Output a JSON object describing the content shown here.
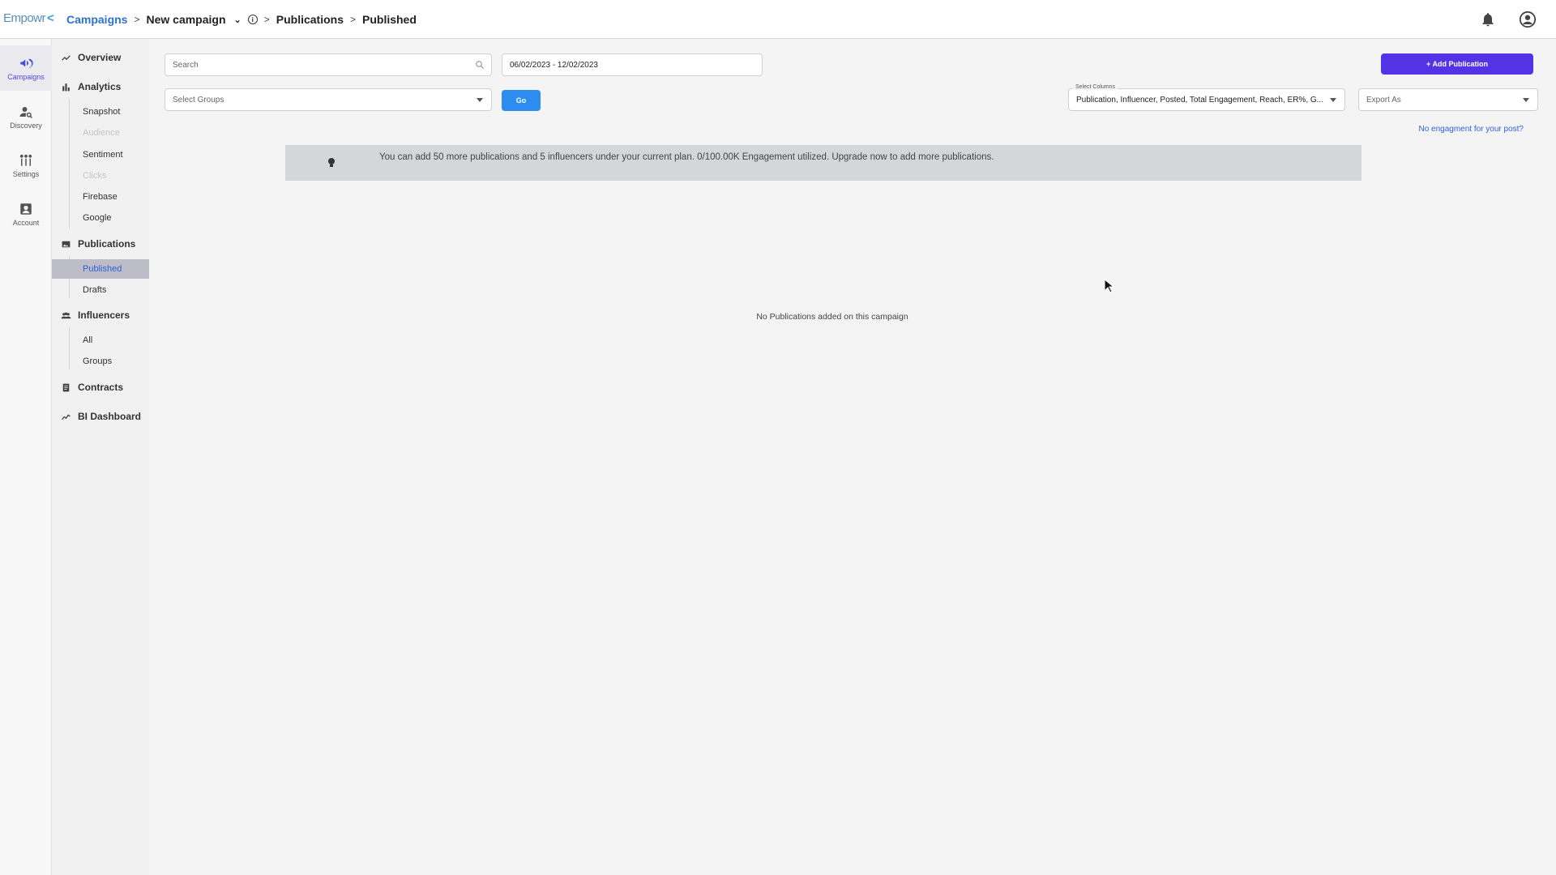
{
  "app": {
    "logo_text": "Empowr",
    "logo_mark": "<"
  },
  "breadcrumb": {
    "campaigns": "Campaigns",
    "campaign_name": "New campaign",
    "publications": "Publications",
    "published": "Published"
  },
  "rail": {
    "campaigns": "Campaigns",
    "discovery": "Discovery",
    "settings": "Settings",
    "account": "Account"
  },
  "sidebar": {
    "overview": "Overview",
    "analytics": "Analytics",
    "analytics_items": [
      "Snapshot",
      "Audience",
      "Sentiment",
      "Clicks",
      "Firebase",
      "Google"
    ],
    "publications": "Publications",
    "publications_items": [
      "Published",
      "Drafts"
    ],
    "influencers": "Influencers",
    "influencers_items": [
      "All",
      "Groups"
    ],
    "contracts": "Contracts",
    "bi_dashboard": "BI Dashboard"
  },
  "toolbar": {
    "search_placeholder": "Search",
    "date_range": "06/02/2023 - 12/02/2023",
    "select_groups_placeholder": "Select Groups",
    "go_label": "Go",
    "add_publication_label": "+ Add Publication",
    "select_columns_label": "Select Columns",
    "select_columns_value": "Publication, Influencer, Posted, Total Engagement, Reach, ER%, G...",
    "export_placeholder": "Export As",
    "no_engagement_link": "No engagment for your post?"
  },
  "banner": {
    "text": "You can add 50 more publications and 5 influencers under your current plan. 0/100.00K Engagement utilized. Upgrade now to add more publications."
  },
  "empty_state": {
    "message": "No Publications added on this campaign"
  },
  "colors": {
    "primary": "#5234e6",
    "go_button": "#2d8cf0",
    "link": "#2e5fe0",
    "breadcrumb_link": "#2e73c9"
  }
}
